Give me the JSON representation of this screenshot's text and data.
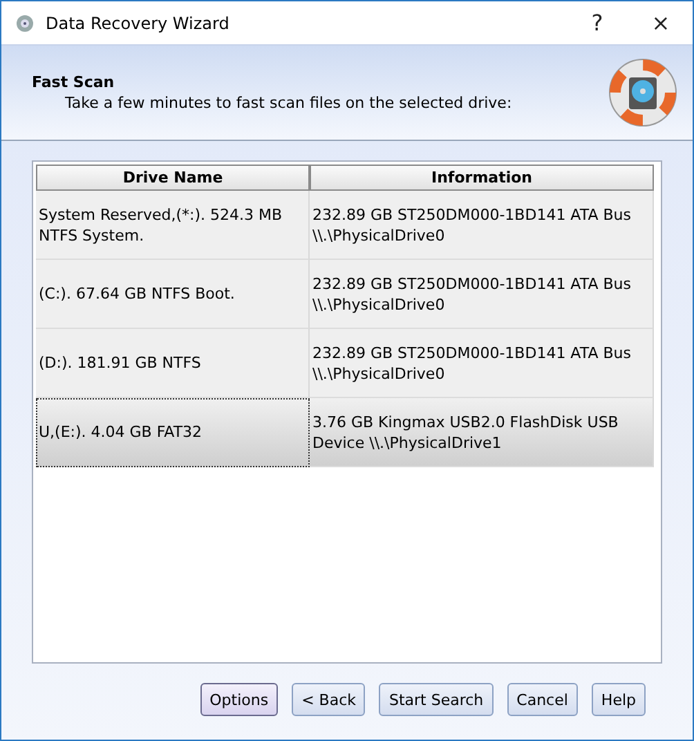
{
  "window": {
    "title": "Data Recovery Wizard",
    "help": "?",
    "close": "×"
  },
  "header": {
    "title": "Fast Scan",
    "subtitle": "Take a few minutes to fast scan files on the selected drive:"
  },
  "table": {
    "columns": [
      "Drive Name",
      "Information"
    ],
    "rows": [
      {
        "drive": "System Reserved,(*:). 524.3 MB NTFS System.",
        "info": "232.89 GB ST250DM000-1BD141 ATA Bus \\\\.\\PhysicalDrive0",
        "selected": false
      },
      {
        "drive": "(C:). 67.64 GB NTFS Boot.",
        "info": "232.89 GB ST250DM000-1BD141 ATA Bus \\\\.\\PhysicalDrive0",
        "selected": false
      },
      {
        "drive": "(D:). 181.91 GB NTFS",
        "info": "232.89 GB ST250DM000-1BD141 ATA Bus \\\\.\\PhysicalDrive0",
        "selected": false
      },
      {
        "drive": "U,(E:). 4.04 GB FAT32",
        "info": "3.76 GB Kingmax  USB2.0 FlashDisk USB Device \\\\.\\PhysicalDrive1",
        "selected": true
      }
    ]
  },
  "buttons": [
    {
      "label": "Options",
      "focused": true
    },
    {
      "label": "< Back",
      "focused": false
    },
    {
      "label": "Start Search",
      "focused": false
    },
    {
      "label": "Cancel",
      "focused": false
    },
    {
      "label": "Help",
      "focused": false
    }
  ]
}
